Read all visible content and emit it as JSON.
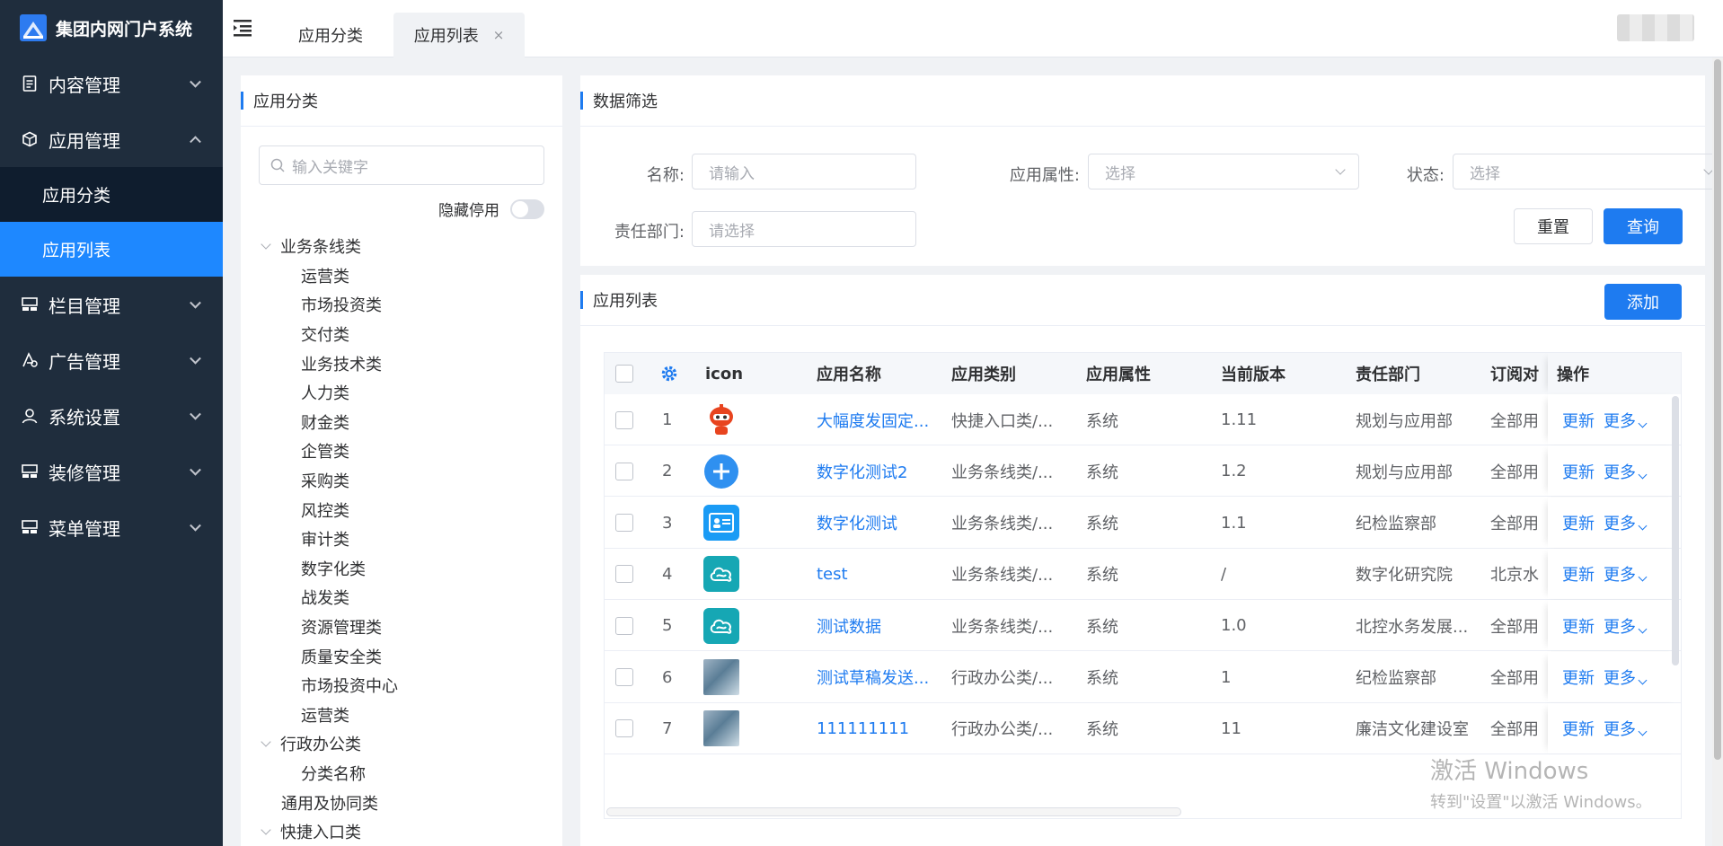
{
  "brand": {
    "title": "集团内网门户系统"
  },
  "sidebar": {
    "items": [
      {
        "label": "内容管理",
        "icon": "document-icon"
      },
      {
        "label": "应用管理",
        "icon": "cube-icon",
        "expanded": true,
        "children": [
          {
            "label": "应用分类"
          },
          {
            "label": "应用列表",
            "active": true
          }
        ]
      },
      {
        "label": "栏目管理",
        "icon": "columns-icon"
      },
      {
        "label": "广告管理",
        "icon": "ad-icon"
      },
      {
        "label": "系统设置",
        "icon": "user-icon"
      },
      {
        "label": "装修管理",
        "icon": "layout-icon"
      },
      {
        "label": "菜单管理",
        "icon": "menu-icon"
      }
    ]
  },
  "header": {
    "tabs": [
      {
        "label": "应用分类"
      },
      {
        "label": "应用列表",
        "active": true,
        "close": "×"
      }
    ]
  },
  "category_panel": {
    "title": "应用分类",
    "search_placeholder": "输入关键字",
    "hide_disabled_label": "隐藏停用",
    "tree": [
      {
        "label": "业务条线类",
        "children": [
          "运营类",
          "市场投资类",
          "交付类",
          "业务技术类",
          "人力类",
          "财金类",
          "企管类",
          "采购类",
          "风控类",
          "审计类",
          "数字化类",
          "战发类",
          "资源管理类",
          "质量安全类",
          "市场投资中心",
          "运营类"
        ]
      },
      {
        "label": "行政办公类",
        "children": [
          "分类名称"
        ]
      },
      {
        "label": "通用及协同类",
        "children": []
      },
      {
        "label": "快捷入口类",
        "children": []
      }
    ]
  },
  "filter": {
    "title": "数据筛选",
    "name_label": "名称:",
    "name_placeholder": "请输入",
    "attr_label": "应用属性:",
    "attr_placeholder": "选择",
    "status_label": "状态:",
    "status_placeholder": "选择",
    "dept_label": "责任部门:",
    "dept_placeholder": "请选择",
    "reset_label": "重置",
    "query_label": "查询"
  },
  "list": {
    "title": "应用列表",
    "add_label": "添加",
    "columns": [
      "icon",
      "应用名称",
      "应用类别",
      "应用属性",
      "当前版本",
      "责任部门",
      "订阅对",
      "操作"
    ],
    "rows": [
      {
        "no": "1",
        "icon": "robot-icon",
        "name": "大幅度发固定...",
        "category": "快捷入口类/...",
        "attr": "系统",
        "version": "1.11",
        "dept": "规划与应用部",
        "sub": "全部用"
      },
      {
        "no": "2",
        "icon": "plus-circle-icon",
        "name": "数字化测试2",
        "category": "业务条线类/...",
        "attr": "系统",
        "version": "1.2",
        "dept": "规划与应用部",
        "sub": "全部用"
      },
      {
        "no": "3",
        "icon": "id-card-icon",
        "name": "数字化测试",
        "category": "业务条线类/...",
        "attr": "系统",
        "version": "1.1",
        "dept": "纪检监察部",
        "sub": "全部用"
      },
      {
        "no": "4",
        "icon": "cloud-icon",
        "name": "test",
        "category": "业务条线类/...",
        "attr": "系统",
        "version": "/",
        "dept": "数字化研究院",
        "sub": "北京水"
      },
      {
        "no": "5",
        "icon": "cloud-icon",
        "name": "测试数据",
        "category": "业务条线类/...",
        "attr": "系统",
        "version": "1.0",
        "dept": "北控水务发展...",
        "sub": "全部用"
      },
      {
        "no": "6",
        "icon": "photo-icon",
        "name": "测试草稿发送...",
        "category": "行政办公类/...",
        "attr": "系统",
        "version": "1",
        "dept": "纪检监察部",
        "sub": "全部用"
      },
      {
        "no": "7",
        "icon": "photo-icon",
        "name": "111111111",
        "category": "行政办公类/...",
        "attr": "系统",
        "version": "11",
        "dept": "廉洁文化建设室",
        "sub": "全部用"
      }
    ],
    "op_update": "更新",
    "op_more": "更多"
  },
  "watermark": {
    "line1": "激活 Windows",
    "line2": "转到\"设置\"以激活 Windows。"
  }
}
